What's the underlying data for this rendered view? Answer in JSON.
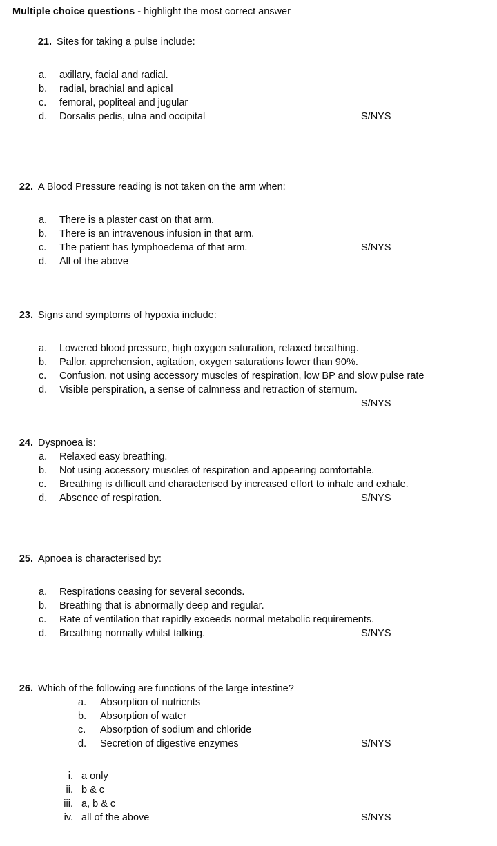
{
  "header": {
    "title_bold": "Multiple choice questions",
    "title_rest": " - highlight the most correct answer"
  },
  "answer_marker": "S/NYS",
  "questions": [
    {
      "number": "21.",
      "stem": "Sites for taking a pulse include:",
      "options": [
        {
          "marker": "a.",
          "text": "axillary, facial and radial."
        },
        {
          "marker": "b.",
          "text": "radial, brachial and apical"
        },
        {
          "marker": "c.",
          "text": "femoral, popliteal and jugular"
        },
        {
          "marker": "d.",
          "text": "Dorsalis pedis, ulna and occipital"
        }
      ]
    },
    {
      "number": "22.",
      "stem": "A Blood Pressure reading is not taken on the arm when:",
      "options": [
        {
          "marker": "a.",
          "text": "There is a plaster cast on that arm."
        },
        {
          "marker": "b.",
          "text": "There is an intravenous infusion in that arm."
        },
        {
          "marker": "c.",
          "text": "The patient has lymphoedema of that arm."
        },
        {
          "marker": "d.",
          "text": "All of the above"
        }
      ]
    },
    {
      "number": "23.",
      "stem": "Signs and symptoms of hypoxia include:",
      "options": [
        {
          "marker": "a.",
          "text": "Lowered blood pressure, high oxygen saturation, relaxed breathing."
        },
        {
          "marker": "b.",
          "text": "Pallor, apprehension, agitation, oxygen saturations lower than 90%."
        },
        {
          "marker": "c.",
          "text": "Confusion, not using accessory muscles of respiration, low BP and slow pulse rate"
        },
        {
          "marker": "d.",
          "text": "Visible perspiration, a sense of calmness and retraction of sternum."
        }
      ]
    },
    {
      "number": "24.",
      "stem": "Dyspnoea is:",
      "options": [
        {
          "marker": "a.",
          "text": "Relaxed easy breathing."
        },
        {
          "marker": "b.",
          "text": "Not using accessory muscles of respiration and appearing comfortable."
        },
        {
          "marker": "c.",
          "text": "Breathing is difficult and characterised by increased effort to inhale and exhale."
        },
        {
          "marker": "d.",
          "text": "Absence of respiration."
        }
      ]
    },
    {
      "number": "25.",
      "stem": "Apnoea is characterised by:",
      "options": [
        {
          "marker": "a.",
          "text": "Respirations ceasing for several seconds."
        },
        {
          "marker": "b.",
          "text": "Breathing that is abnormally deep and regular."
        },
        {
          "marker": "c.",
          "text": "Rate of ventilation that rapidly exceeds normal metabolic requirements."
        },
        {
          "marker": "d.",
          "text": "Breathing normally whilst talking."
        }
      ]
    },
    {
      "number": "26.",
      "stem": "Which of the following are functions of the large intestine?",
      "options": [
        {
          "marker": "a.",
          "text": "Absorption of nutrients"
        },
        {
          "marker": "b.",
          "text": "Absorption of water"
        },
        {
          "marker": "c.",
          "text": "Absorption of sodium and chloride"
        },
        {
          "marker": "d.",
          "text": "Secretion of digestive enzymes"
        }
      ],
      "sub_options": [
        {
          "marker": "i.",
          "text": "a only"
        },
        {
          "marker": "ii.",
          "text": "b & c"
        },
        {
          "marker": "iii.",
          "text": "a, b & c"
        },
        {
          "marker": "iv.",
          "text": "all of the above"
        }
      ]
    }
  ]
}
